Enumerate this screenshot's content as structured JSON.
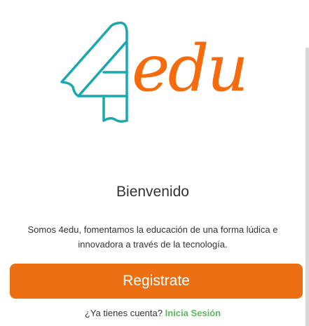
{
  "logo": {
    "number": "4",
    "text": "edu",
    "colors": {
      "four": "#1aa8b0",
      "edu": "#f76b0e"
    }
  },
  "welcome": {
    "title": "Bienvenido",
    "description": "Somos 4edu, fomentamos la educación de una forma lúdica e innovadora a través de la tecnología."
  },
  "register_button": {
    "label": "Registrate",
    "color": "#ec6f12"
  },
  "login_prompt": {
    "question": "¿Ya tienes cuenta?",
    "link": "Inicia Sesión",
    "link_color": "#5cb85c"
  }
}
